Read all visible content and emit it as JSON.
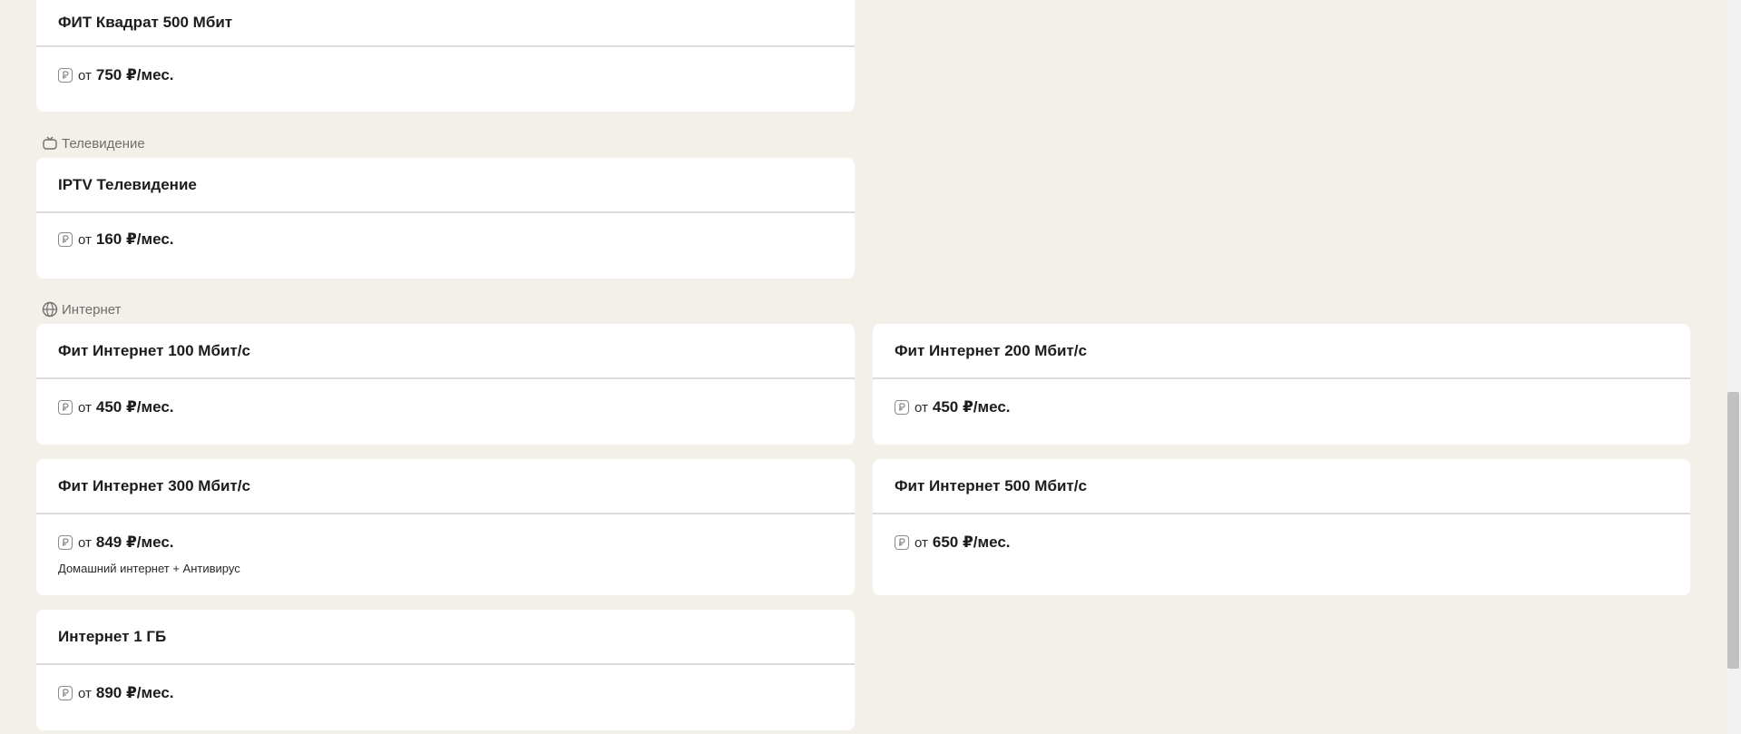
{
  "sections": {
    "tv": {
      "label": "Телевидение",
      "icon": "tv-icon"
    },
    "internet": {
      "label": "Интернет",
      "icon": "globe-icon"
    }
  },
  "cards": [
    {
      "title": "ФИТ Квадрат 500 Мбит",
      "from": "от",
      "price": "750 ₽/мес.",
      "note": ""
    },
    {
      "title": "IPTV Телевидение",
      "from": "от",
      "price": "160 ₽/мес.",
      "note": ""
    },
    {
      "title": "Фит Интернет 100 Мбит/с",
      "from": "от",
      "price": "450 ₽/мес.",
      "note": ""
    },
    {
      "title": "Фит Интернет 200 Мбит/с",
      "from": "от",
      "price": "450 ₽/мес.",
      "note": ""
    },
    {
      "title": "Фит Интернет 300 Мбит/с",
      "from": "от",
      "price": "849 ₽/мес.",
      "note": "Домашний интернет + Антивирус"
    },
    {
      "title": "Фит Интернет 500 Мбит/с",
      "from": "от",
      "price": "650 ₽/мес.",
      "note": ""
    },
    {
      "title": "Интернет 1 ГБ",
      "from": "от",
      "price": "890 ₽/мес.",
      "note": ""
    }
  ],
  "colors": {
    "background": "#f3f0e9",
    "card": "#ffffff",
    "divider": "#dcdcdc",
    "muted_text": "#6e6e6e"
  }
}
